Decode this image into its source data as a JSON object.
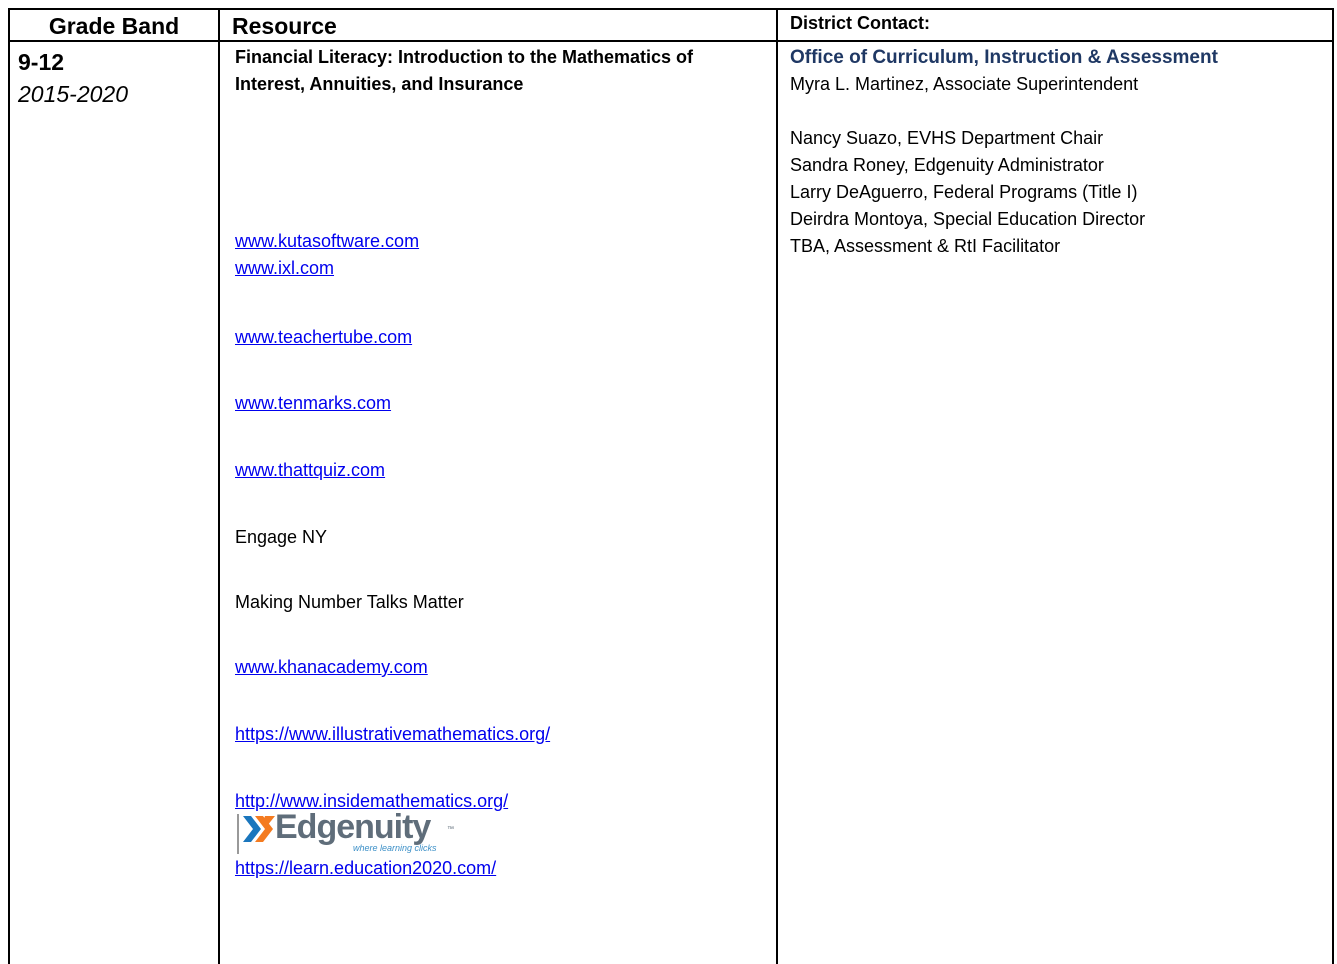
{
  "headers": {
    "grade_band": "Grade Band",
    "resource": "Resource",
    "district_contact": "District Contact:"
  },
  "grade": {
    "band": "9-12",
    "years": "2015-2020"
  },
  "resource": {
    "title": "Financial Literacy: Introduction to the Mathematics of Interest, Annuities, and Insurance",
    "items": [
      {
        "text": "www.kutasoftware.com",
        "link": true
      },
      {
        "text": "www.ixl.com",
        "link": true
      },
      {
        "text": "www.teachertube.com",
        "link": true
      },
      {
        "text": "www.tenmarks.com",
        "link": true
      },
      {
        "text": "www.thattquiz.com",
        "link": true
      },
      {
        "text": "Engage NY",
        "link": false
      },
      {
        "text": "Making Number Talks Matter",
        "link": false
      },
      {
        "text": "www.khanacademy.com",
        "link": true
      },
      {
        "text": "https://www.illustrativemathematics.org/",
        "link": true
      },
      {
        "text": "http://www.insidemathematics.org/",
        "link": true
      },
      {
        "text": "https://learn.education2020.com/",
        "link": true
      }
    ],
    "logo": {
      "brand": "Edgenuity",
      "tagline": "where learning clicks",
      "tm": "™",
      "icon": "edgenuity-x-logo-icon",
      "colors": {
        "orange": "#f47b20",
        "blue": "#1a76bd",
        "text": "#5f6d7a"
      }
    }
  },
  "contact": {
    "office": "Office of Curriculum, Instruction & Assessment",
    "lead": "Myra L. Martinez, Associate Superintendent",
    "people": [
      "Nancy Suazo, EVHS Department Chair",
      "Sandra Roney, Edgenuity Administrator",
      "Larry DeAguerro, Federal Programs (Title I)",
      "Deirdra Montoya, Special Education Director",
      "TBA, Assessment & RtI Facilitator"
    ],
    "office_color": "#1f3864"
  },
  "link_color": "#0000ee"
}
